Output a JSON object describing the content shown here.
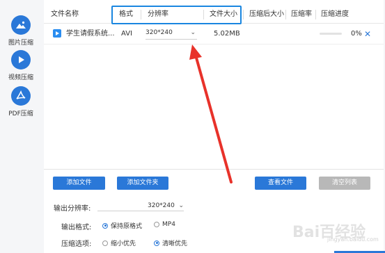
{
  "sidebar": {
    "items": [
      {
        "label": "图片压缩",
        "icon": "image-icon"
      },
      {
        "label": "视频压缩",
        "icon": "play-icon"
      },
      {
        "label": "PDF压缩",
        "icon": "pdf-icon"
      }
    ]
  },
  "table": {
    "headers": {
      "filename": "文件名称",
      "format": "格式",
      "resolution": "分辨率",
      "filesize": "文件大小",
      "compressed_size": "压缩后大小",
      "ratio": "压缩率",
      "progress": "压缩进度"
    },
    "rows": [
      {
        "name": "学生请假系统...",
        "format": "AVI",
        "resolution": "320*240",
        "size": "5.02MB",
        "compressed_size": "",
        "ratio": "",
        "progress_percent": 0,
        "progress_text": "0%"
      }
    ]
  },
  "buttons": {
    "add_file": "添加文件",
    "add_folder": "添加文件夹",
    "view_file": "查看文件",
    "clear_list": "清空列表"
  },
  "options": {
    "output_resolution_label": "输出分辨率:",
    "output_resolution_value": "320*240",
    "output_format_label": "输出格式:",
    "format_options": [
      {
        "label": "保持原格式",
        "selected": true
      },
      {
        "label": "MP4",
        "selected": false
      }
    ],
    "compress_label": "压缩选项:",
    "compress_options": [
      {
        "label": "缩小优先",
        "selected": false
      },
      {
        "label": "清晰优先",
        "selected": true
      }
    ]
  },
  "watermark": {
    "text": "Bai百经验",
    "sub": "jingyan.baidu.com"
  },
  "colors": {
    "accent": "#2a78d8",
    "highlight_box": "#1a86e0",
    "arrow": "#e8322a"
  }
}
